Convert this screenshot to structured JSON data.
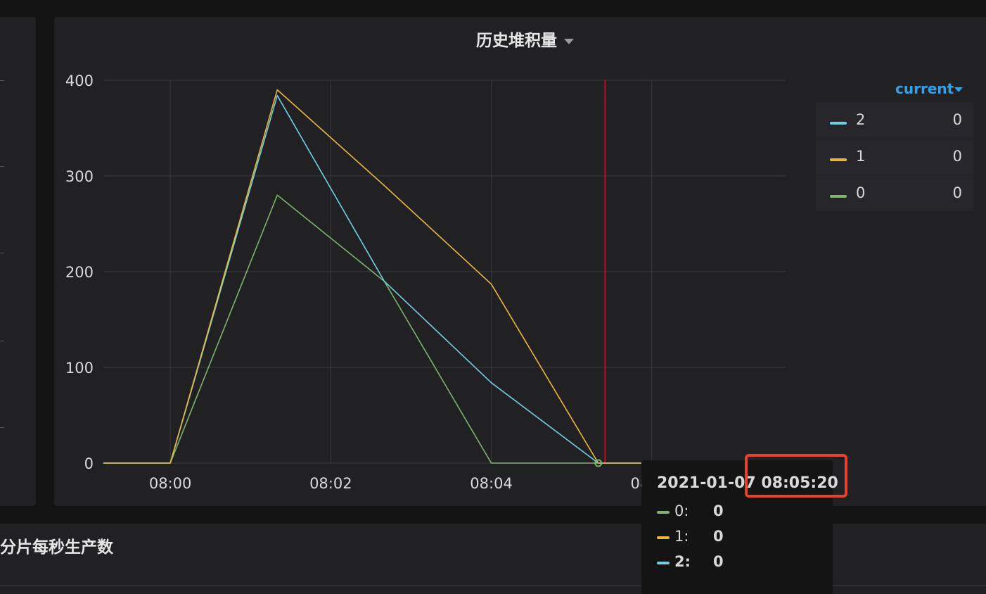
{
  "panels": {
    "main_title": "历史堆积量",
    "bottom_title": "分片每秒生产数"
  },
  "colors": {
    "series_0": "#7eb26d",
    "series_1": "#eab839",
    "series_2": "#6ed0e0",
    "annotation": "#c4162a",
    "grid": "#3b3b3f",
    "highlight": "#e8402a",
    "legend_header": "#33a2e5"
  },
  "chart_data": {
    "type": "line",
    "title": "历史堆积量",
    "x": [
      "07:59:10",
      "08:00:00",
      "08:01:20",
      "08:02:40",
      "08:04:00",
      "08:05:20",
      "08:06:40"
    ],
    "xticks": [
      "08:00",
      "08:02",
      "08:04",
      "08:06"
    ],
    "xlim": [
      "07:59:10",
      "08:07:40"
    ],
    "yticks": [
      0,
      100,
      200,
      300,
      400
    ],
    "ylim": [
      0,
      400
    ],
    "grid": true,
    "annotation_time": "08:05:25",
    "series": [
      {
        "name": "0",
        "values": [
          0,
          0,
          280,
          190,
          0,
          0,
          0
        ]
      },
      {
        "name": "1",
        "values": [
          0,
          0,
          390,
          290,
          187,
          0,
          0
        ]
      },
      {
        "name": "2",
        "values": [
          0,
          0,
          384,
          190,
          84,
          0,
          0
        ]
      }
    ]
  },
  "legend": {
    "header": "current",
    "items": [
      {
        "name": "2",
        "value": "0"
      },
      {
        "name": "1",
        "value": "0"
      },
      {
        "name": "0",
        "value": "0"
      }
    ]
  },
  "tooltip": {
    "time": "2021-01-07 08:05:20",
    "rows": [
      {
        "name": "0:",
        "value": "0"
      },
      {
        "name": "1:",
        "value": "0"
      },
      {
        "name": "2:",
        "value": "0"
      }
    ]
  }
}
